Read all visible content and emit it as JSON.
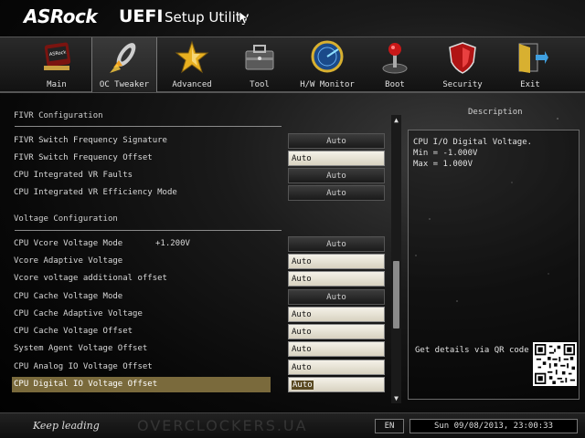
{
  "header": {
    "brand": "ASRock",
    "product": "UEFI",
    "subtitle": "Setup Utility"
  },
  "nav": {
    "tabs": [
      {
        "label": "Main",
        "icon": "main-icon"
      },
      {
        "label": "OC Tweaker",
        "icon": "rocket-icon",
        "active": true
      },
      {
        "label": "Advanced",
        "icon": "star-icon"
      },
      {
        "label": "Tool",
        "icon": "toolbox-icon"
      },
      {
        "label": "H/W Monitor",
        "icon": "radar-icon"
      },
      {
        "label": "Boot",
        "icon": "joystick-icon"
      },
      {
        "label": "Security",
        "icon": "shield-icon"
      },
      {
        "label": "Exit",
        "icon": "exit-door-icon"
      }
    ]
  },
  "settings": {
    "fivr_heading": "FIVR Configuration",
    "voltage_heading": "Voltage Configuration",
    "fivr_rows": [
      {
        "label": "FIVR Switch Frequency Signature",
        "value": "Auto",
        "kind": "button"
      },
      {
        "label": "FIVR Switch Frequency Offset",
        "value": "Auto",
        "kind": "field"
      },
      {
        "label": "CPU Integrated VR Faults",
        "value": "Auto",
        "kind": "button"
      },
      {
        "label": "CPU Integrated VR Efficiency Mode",
        "value": "Auto",
        "kind": "button"
      }
    ],
    "voltage_rows": [
      {
        "label": "CPU Vcore Voltage Mode",
        "extra": "+1.200V",
        "value": "Auto",
        "kind": "button"
      },
      {
        "label": "Vcore Adaptive Voltage",
        "value": "Auto",
        "kind": "field"
      },
      {
        "label": "Vcore voltage additional offset",
        "value": "Auto",
        "kind": "field"
      },
      {
        "label": "CPU Cache Voltage Mode",
        "value": "Auto",
        "kind": "button"
      },
      {
        "label": "CPU Cache Adaptive Voltage",
        "value": "Auto",
        "kind": "field"
      },
      {
        "label": "CPU Cache Voltage Offset",
        "value": "Auto",
        "kind": "field"
      },
      {
        "label": "System Agent Voltage Offset",
        "value": "Auto",
        "kind": "field"
      },
      {
        "label": "CPU Analog IO Voltage Offset",
        "value": "Auto",
        "kind": "field"
      },
      {
        "label": "CPU Digital IO Voltage Offset",
        "value": "Auto",
        "kind": "field",
        "selected": true
      }
    ]
  },
  "description": {
    "title": "Description",
    "lines": [
      "CPU I/O Digital Voltage.",
      "Min = -1.000V",
      "Max = 1.000V"
    ],
    "qr_text": "Get details via QR code"
  },
  "footer": {
    "slogan": "Keep leading",
    "watermark": "OVERCLOCKERS.UA",
    "language": "EN",
    "datetime": "Sun 09/08/2013, 23:00:33"
  }
}
